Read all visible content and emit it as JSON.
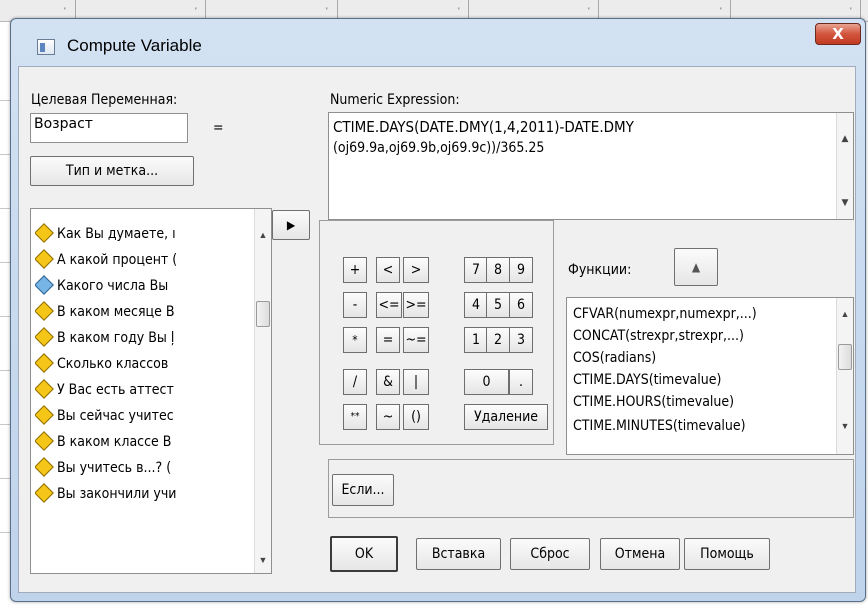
{
  "background": {
    "marks": [
      "'",
      "'",
      "'",
      "'",
      "'",
      "'",
      "'"
    ]
  },
  "window": {
    "title": "Compute Variable",
    "close_label": "X"
  },
  "target": {
    "label": "Целевая Переменная:",
    "value": "Возраст",
    "equals": "=",
    "type_label_button": "Тип и метка..."
  },
  "expression": {
    "label": "Numeric Expression:",
    "lines": [
      "CTIME.DAYS(DATE.DMY(1,4,2011)-DATE.DMY",
      "(oj69.9a,oj69.9b,oj69.9c))/365.25"
    ]
  },
  "move_button": "▶",
  "variables": [
    {
      "label": "Как Вы думаете, ı",
      "icon": "yellow-diamond-icon"
    },
    {
      "label": "А какой процент (",
      "icon": "yellow-diamond-icon"
    },
    {
      "label": "Какого числа Вы",
      "icon": "blue-diamond-icon"
    },
    {
      "label": "В каком месяце В",
      "icon": "yellow-diamond-icon"
    },
    {
      "label": "В каком году Вы ļ",
      "icon": "yellow-diamond-icon"
    },
    {
      "label": "Сколько классов",
      "icon": "yellow-diamond-icon"
    },
    {
      "label": "У Вас есть аттест",
      "icon": "yellow-diamond-icon"
    },
    {
      "label": "Вы сейчас учитес",
      "icon": "yellow-diamond-icon"
    },
    {
      "label": "В каком классе В",
      "icon": "yellow-diamond-icon"
    },
    {
      "label": "Вы учитесь в...? (",
      "icon": "yellow-diamond-icon"
    },
    {
      "label": "Вы закончили учи",
      "icon": "yellow-diamond-icon"
    }
  ],
  "keypad": {
    "keys": [
      "+",
      "<",
      ">",
      "7",
      "8",
      "9",
      "-",
      "<=",
      ">=",
      "4",
      "5",
      "6",
      "*",
      "=",
      "~=",
      "1",
      "2",
      "3",
      "/",
      "&",
      "|",
      "0",
      ".",
      "**",
      "~",
      "()",
      "Удаление"
    ]
  },
  "functions": {
    "label": "Функции:",
    "up_button": "▲",
    "items": [
      "CFVAR(numexpr,numexpr,...)",
      "CONCAT(strexpr,strexpr,...)",
      "COS(radians)",
      "CTIME.DAYS(timevalue)",
      "CTIME.HOURS(timevalue)",
      "CTIME.MINUTES(timevalue)"
    ]
  },
  "if_button": "Если...",
  "buttons": {
    "ok": "OK",
    "paste": "Вставка",
    "reset": "Сброс",
    "cancel": "Отмена",
    "help": "Помощь"
  }
}
